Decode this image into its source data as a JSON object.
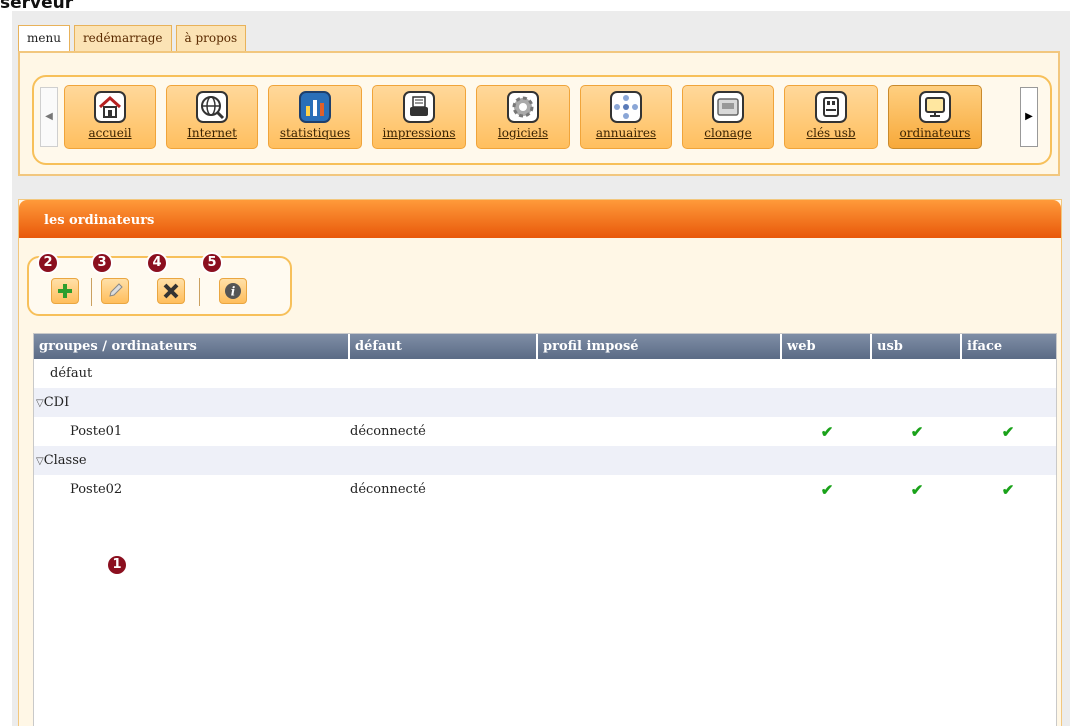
{
  "caption": "serveur",
  "tabs": [
    {
      "label": "menu",
      "active": true
    },
    {
      "label": "redémarrage",
      "active": false
    },
    {
      "label": "à propos",
      "active": false
    }
  ],
  "menu_items": [
    {
      "label": "accueil",
      "icon": "home-icon"
    },
    {
      "label": "Internet",
      "icon": "globe-icon"
    },
    {
      "label": "statistiques",
      "icon": "bar-chart-icon"
    },
    {
      "label": "impressions",
      "icon": "printer-icon"
    },
    {
      "label": "logiciels",
      "icon": "gear-icon"
    },
    {
      "label": "annuaires",
      "icon": "directory-icon"
    },
    {
      "label": "clonage",
      "icon": "disk-icon"
    },
    {
      "label": "clés usb",
      "icon": "usb-icon"
    },
    {
      "label": "ordinateurs",
      "icon": "monitor-icon",
      "active": true
    }
  ],
  "panel": {
    "title": "les ordinateurs"
  },
  "actions": [
    {
      "name": "add",
      "icon": "plus-icon",
      "color": "#2e9e2e"
    },
    {
      "name": "edit",
      "icon": "pencil-icon"
    },
    {
      "name": "delete",
      "icon": "x-icon"
    },
    {
      "name": "info",
      "icon": "info-icon"
    }
  ],
  "badges": [
    "1",
    "2",
    "3",
    "4",
    "5"
  ],
  "table": {
    "columns": [
      "groupes / ordinateurs",
      "défaut",
      "profil imposé",
      "web",
      "usb",
      "iface"
    ],
    "rows": [
      {
        "type": "item",
        "name": "défaut",
        "status": "",
        "profile": "",
        "web": false,
        "usb": false,
        "iface": false
      },
      {
        "type": "group",
        "name": "CDI",
        "expanded": true
      },
      {
        "type": "item",
        "name": "Poste01",
        "status": "déconnecté",
        "profile": "",
        "web": true,
        "usb": true,
        "iface": true
      },
      {
        "type": "group",
        "name": "Classe",
        "expanded": true
      },
      {
        "type": "item",
        "name": "Poste02",
        "status": "déconnecté",
        "profile": "",
        "web": true,
        "usb": true,
        "iface": true
      }
    ],
    "check_glyph": "✔"
  },
  "colors": {
    "accent": "#e8580a",
    "header": "#5b6b85",
    "badge": "#8b0f1f",
    "check": "#1aa21a"
  }
}
